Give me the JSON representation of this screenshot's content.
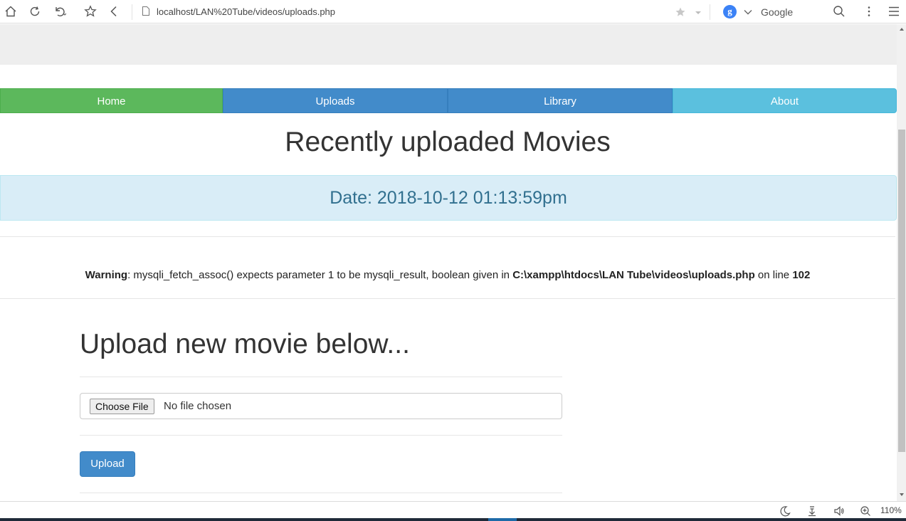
{
  "browser": {
    "url": "localhost/LAN%20Tube/videos/uploads.php",
    "search_engine": "Google",
    "search_engine_badge": "g",
    "zoom": "110%"
  },
  "nav": {
    "items": [
      {
        "label": "Home",
        "color": "#5cb85c"
      },
      {
        "label": "Uploads",
        "color": "#428bca"
      },
      {
        "label": "Library",
        "color": "#428bca"
      },
      {
        "label": "About",
        "color": "#5bc0de"
      }
    ]
  },
  "main": {
    "title": "Recently uploaded Movies",
    "date_text": "Date: 2018-10-12 01:13:59pm",
    "warning": {
      "label": "Warning",
      "message": ": mysqli_fetch_assoc() expects parameter 1 to be mysqli_result, boolean given in ",
      "path": "C:\\xampp\\htdocs\\LAN Tube\\videos\\uploads.php",
      "on_line": " on line ",
      "line": "102"
    }
  },
  "upload_form": {
    "heading": "Upload new movie below...",
    "choose_file_label": "Choose File",
    "file_status": "No file chosen",
    "submit_label": "Upload"
  }
}
